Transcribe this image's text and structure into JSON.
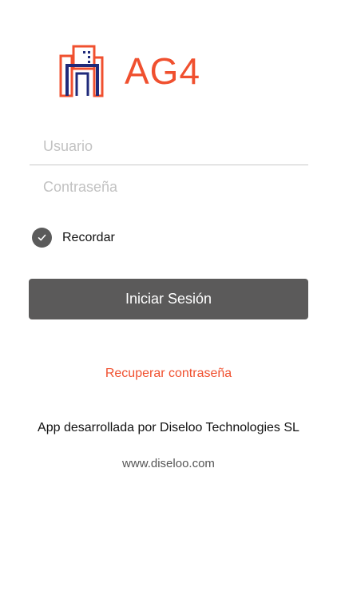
{
  "logo": {
    "text": "AG4",
    "icon": "building-icon"
  },
  "form": {
    "username_placeholder": "Usuario",
    "username_value": "",
    "password_placeholder": "Contraseña",
    "password_value": "",
    "remember_label": "Recordar",
    "remember_checked": true,
    "submit_label": "Iniciar Sesión"
  },
  "links": {
    "recover_password": "Recuperar contraseña"
  },
  "footer": {
    "credit": "App desarrollada por Diseloo Technologies SL",
    "website": "www.diseloo.com"
  },
  "colors": {
    "accent": "#f0502f",
    "button": "#5b5a5a",
    "check": "#5b5b5b",
    "logo_blue": "#1f2a7a"
  }
}
